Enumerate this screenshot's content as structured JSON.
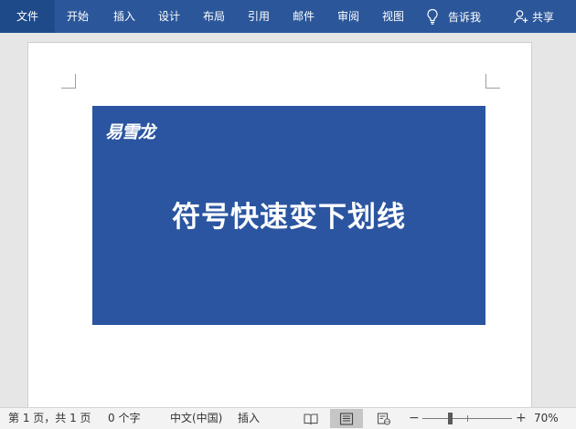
{
  "ribbon": {
    "tabs": [
      "文件",
      "开始",
      "插入",
      "设计",
      "布局",
      "引用",
      "邮件",
      "审阅",
      "视图"
    ],
    "tell_me": "告诉我",
    "share": "共享"
  },
  "document": {
    "brand": "易雪龙",
    "headline": "符号快速变下划线"
  },
  "status": {
    "page": "第 1 页，共 1 页",
    "words": "0 个字",
    "language": "中文(中国)",
    "mode": "插入",
    "zoom_minus": "−",
    "zoom_plus": "+",
    "zoom": "70%"
  },
  "colors": {
    "ribbon": "#2b579a",
    "banner": "#2b55a0"
  }
}
